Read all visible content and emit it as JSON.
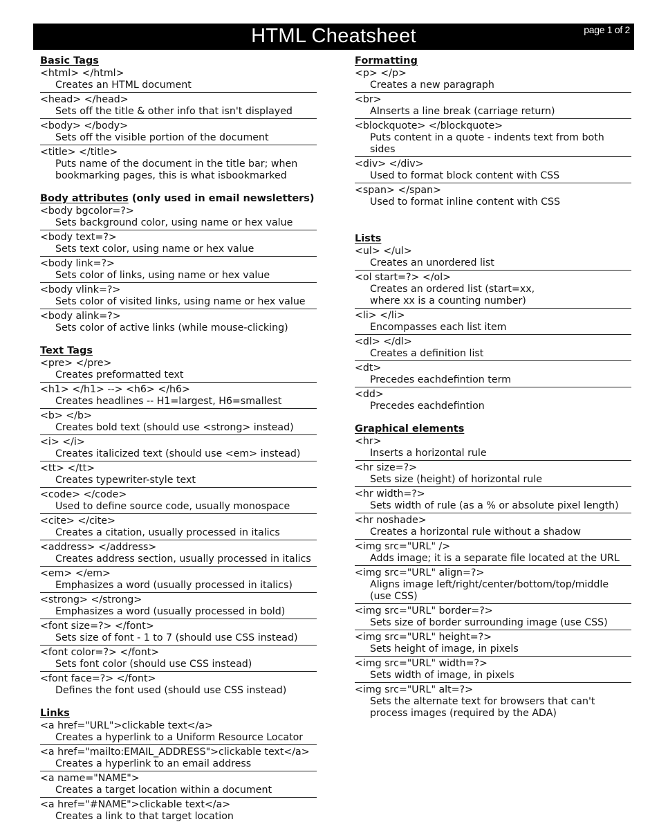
{
  "header": {
    "title": "HTML Cheatsheet",
    "page_indicator": "page 1 of 2"
  },
  "left_column": [
    {
      "title": "Basic Tags",
      "title_suffix": "",
      "entries": [
        {
          "tag": "<html> </html>",
          "desc": "Creates an HTML document"
        },
        {
          "tag": "<head> </head>",
          "desc": "Sets off the title & other info that isn't displayed"
        },
        {
          "tag": "<body> </body>",
          "desc": "Sets off the visible portion of the document"
        },
        {
          "tag": "<title> </title>",
          "desc": "Puts name of the document in the title bar; when\nbookmarking pages, this is what isbookmarked"
        }
      ]
    },
    {
      "title": "Body attributes",
      "title_suffix": " (only used in email newsletters)",
      "entries": [
        {
          "tag": "<body bgcolor=?>",
          "desc": "Sets background color, using name or hex value"
        },
        {
          "tag": "<body text=?>",
          "desc": "Sets text color, using name or hex value"
        },
        {
          "tag": "<body link=?>",
          "desc": "Sets color of links, using name or hex value"
        },
        {
          "tag": "<body vlink=?>",
          "desc": "Sets color of visited links, using name or hex value"
        },
        {
          "tag": "<body alink=?>",
          "desc": "Sets color of active links (while mouse-clicking)"
        }
      ]
    },
    {
      "title": "Text Tags",
      "title_suffix": "",
      "entries": [
        {
          "tag": "<pre> </pre>",
          "desc": "Creates preformatted text"
        },
        {
          "tag": "<h1> </h1> --> <h6> </h6>",
          "desc": "Creates headlines -- H1=largest, H6=smallest"
        },
        {
          "tag": "<b> </b>",
          "desc": "Creates bold text (should use <strong> instead)"
        },
        {
          "tag": "<i> </i>",
          "desc": "Creates italicized text (should use <em> instead)"
        },
        {
          "tag": "<tt> </tt>",
          "desc": "Creates typewriter-style text"
        },
        {
          "tag": "<code> </code>",
          "desc": "Used to define source code, usually monospace"
        },
        {
          "tag": "<cite> </cite>",
          "desc": "Creates a citation, usually processed in italics"
        },
        {
          "tag": "<address> </address>",
          "desc": "Creates address section, usually processed in italics"
        },
        {
          "tag": "<em> </em>",
          "desc": "Emphasizes a word (usually processed in italics)"
        },
        {
          "tag": "<strong> </strong>",
          "desc": "Emphasizes a word (usually processed in bold)"
        },
        {
          "tag": "<font size=?> </font>",
          "desc": "Sets size of font - 1 to 7 (should use CSS instead)"
        },
        {
          "tag": "<font color=?> </font>",
          "desc": "Sets font color (should use CSS instead)"
        },
        {
          "tag": "<font face=?> </font>",
          "desc": "Defines the font used (should use CSS instead)"
        }
      ]
    },
    {
      "title": "Links",
      "title_suffix": "",
      "entries": [
        {
          "tag": "<a href=\"URL\">clickable text</a>",
          "desc": "Creates a hyperlink to a Uniform Resource Locator"
        },
        {
          "tag": "<a href=\"mailto:EMAIL_ADDRESS\">clickable text</a>",
          "desc": "Creates a hyperlink to an email address"
        },
        {
          "tag": "<a name=\"NAME\">",
          "desc": "Creates a target location within a document"
        },
        {
          "tag": "<a href=\"#NAME\">clickable text</a>",
          "desc": "Creates a link to that target location"
        }
      ]
    }
  ],
  "right_column": [
    {
      "title": "Formatting",
      "title_suffix": "",
      "entries": [
        {
          "tag": "<p> </p>",
          "desc": "Creates a new paragraph"
        },
        {
          "tag": "<br>",
          "desc": "AInserts a line break (carriage return)"
        },
        {
          "tag": "<blockquote> </blockquote>",
          "desc": "Puts content in a quote - indents text from both sides"
        },
        {
          "tag": "<div> </div>",
          "desc": "Used to format block content with CSS"
        },
        {
          "tag": "<span> </span>",
          "desc": "Used to format inline content with CSS"
        }
      ]
    },
    {
      "title": "Lists",
      "title_suffix": "",
      "entries": [
        {
          "tag": "<ul> </ul>",
          "desc": "Creates an unordered list"
        },
        {
          "tag": "<ol start=?> </ol>",
          "desc": "Creates an ordered list (start=xx,\nwhere xx is a counting number)"
        },
        {
          "tag": "<li> </li>",
          "desc": "Encompasses each list item"
        },
        {
          "tag": "<dl> </dl>",
          "desc": "Creates a definition list"
        },
        {
          "tag": "<dt>",
          "desc": "Precedes eachdefintion term"
        },
        {
          "tag": "<dd>",
          "desc": "Precedes eachdefintion"
        }
      ]
    },
    {
      "title": "Graphical elements",
      "title_suffix": "",
      "entries": [
        {
          "tag": "<hr>",
          "desc": "Inserts a horizontal rule"
        },
        {
          "tag": "<hr size=?>",
          "desc": "Sets size (height) of horizontal rule"
        },
        {
          "tag": "<hr width=?>",
          "desc": "Sets width of rule (as a % or absolute pixel length)"
        },
        {
          "tag": "<hr noshade>",
          "desc": "Creates a horizontal rule without a shadow"
        },
        {
          "tag": "<img src=\"URL\" />",
          "desc": "Adds image; it is a separate file located at the URL"
        },
        {
          "tag": "<img src=\"URL\" align=?>",
          "desc": "Aligns image left/right/center/bottom/top/middle (use CSS)"
        },
        {
          "tag": "<img src=\"URL\" border=?>",
          "desc": "Sets size of border surrounding image (use CSS)"
        },
        {
          "tag": "<img src=\"URL\" height=?>",
          "desc": "Sets height of image, in pixels"
        },
        {
          "tag": "<img src=\"URL\" width=?>",
          "desc": "Sets width of image, in pixels"
        },
        {
          "tag": "<img src=\"URL\" alt=?>",
          "desc": "Sets the alternate text for browsers that can't\nprocess images (required by the ADA)"
        }
      ]
    }
  ]
}
